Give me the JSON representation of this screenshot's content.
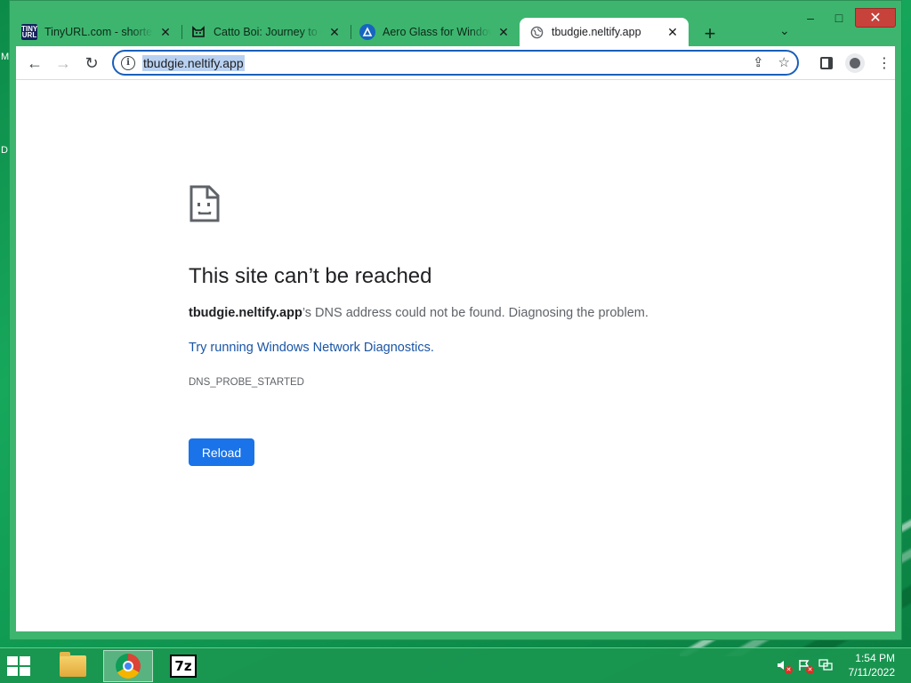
{
  "desktop": {
    "edge_letters": [
      "M",
      "D"
    ]
  },
  "window": {
    "caption": {
      "minimize": "–",
      "maximize": "□",
      "close": "✕"
    }
  },
  "tabs": [
    {
      "title": "TinyURL.com - shortener",
      "favicon": "tinyurl-icon",
      "favicon_text": "TINY URL",
      "active": false
    },
    {
      "title": "Catto Boi: Journey to Catto",
      "favicon": "cat-icon",
      "active": false
    },
    {
      "title": "Aero Glass for Windows",
      "favicon": "aero-glass-icon",
      "active": false
    },
    {
      "title": "tbudgie.neltify.app",
      "favicon": "globe-icon",
      "active": true
    }
  ],
  "tab_close_glyph": "✕",
  "new_tab_glyph": "+",
  "tab_search_glyph": "⌄",
  "toolbar": {
    "back": "←",
    "forward": "→",
    "reload": "↻",
    "info": "i",
    "url": "tbudgie.neltify.app",
    "share": "⇪",
    "bookmark": "☆",
    "menu": "⋮"
  },
  "error_page": {
    "title": "This site can’t be reached",
    "host": "tbudgie.neltify.app",
    "desc_rest": "’s DNS address could not be found. Diagnosing the problem.",
    "link": "Try running Windows Network Diagnostics",
    "link_suffix": ".",
    "code": "DNS_PROBE_STARTED",
    "reload_label": "Reload"
  },
  "taskbar": {
    "apps": [
      "file-explorer",
      "chrome",
      "7-zip"
    ],
    "sevenzip_label": "7z",
    "clock": {
      "time": "1:54 PM",
      "date": "7/11/2022"
    }
  },
  "colors": {
    "accent_blue": "#1a73e8",
    "link_blue": "#1a55a5",
    "window_frame": "#3db56f",
    "close_red": "#c7423a"
  }
}
